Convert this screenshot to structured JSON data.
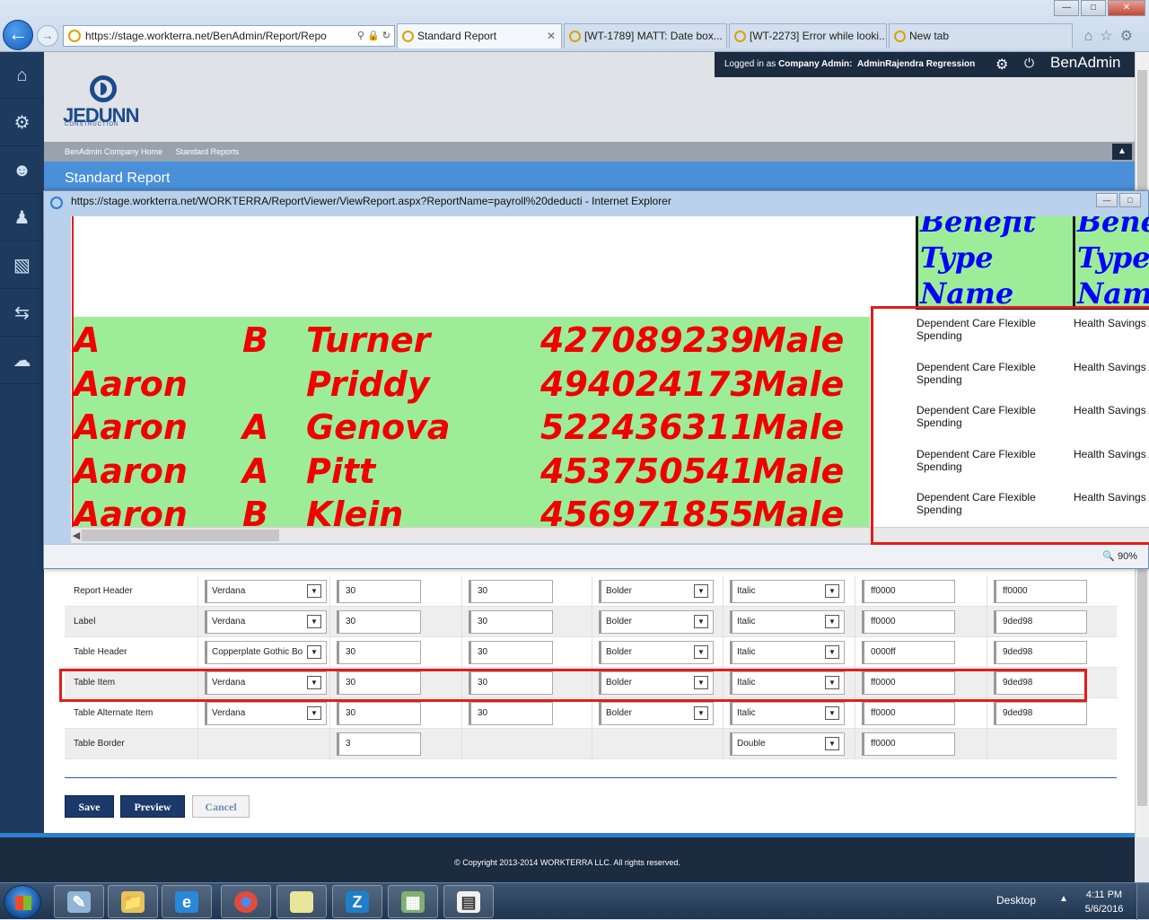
{
  "browser": {
    "address": "https://stage.workterra.net/BenAdmin/Report/Repo",
    "tabs": [
      {
        "label": "Standard Report"
      },
      {
        "label": "[WT-1789] MATT: Date box..."
      },
      {
        "label": "[WT-2273] Error while looki..."
      },
      {
        "label": "New tab"
      }
    ]
  },
  "header": {
    "logo_word": "JEDUNN",
    "logo_sub": "CONSTRUCTION",
    "logged_in_prefix": "Logged in as",
    "user_role": "Company Admin:",
    "user_name": "AdminRajendra Regression",
    "app_name": "BenAdmin"
  },
  "breadcrumb": [
    "BenAdmin Company Home",
    "Standard Reports"
  ],
  "page_title": "Standard Report",
  "popup": {
    "title": "https://stage.workterra.net/WORKTERRA/ReportViewer/ViewReport.aspx?ReportName=payroll%20deducti - Internet Explorer",
    "header_col1": "Benefit Type Name",
    "header_col2": "Benefit Type Name",
    "rows": [
      {
        "first": "A",
        "middle": "B",
        "last": "Turner",
        "ssn": "427089239",
        "gender": "Male",
        "benefit1": "Dependent Care Flexible Spending",
        "benefit2": "Health Savings Accou"
      },
      {
        "first": "Aaron",
        "middle": "",
        "last": "Priddy",
        "ssn": "494024173",
        "gender": "Male",
        "benefit1": "Dependent Care Flexible Spending",
        "benefit2": "Health Savings Accou"
      },
      {
        "first": "Aaron",
        "middle": "A",
        "last": "Genova",
        "ssn": "522436311",
        "gender": "Male",
        "benefit1": "Dependent Care Flexible Spending",
        "benefit2": "Health Savings Accou"
      },
      {
        "first": "Aaron",
        "middle": "A",
        "last": "Pitt",
        "ssn": "453750541",
        "gender": "Male",
        "benefit1": "Dependent Care Flexible Spending",
        "benefit2": "Health Savings Accou"
      },
      {
        "first": "Aaron",
        "middle": "B",
        "last": "Klein",
        "ssn": "456971855",
        "gender": "Male",
        "benefit1": "Dependent Care Flexible Spending",
        "benefit2": "Health Savings Accou"
      }
    ],
    "zoom": "90%"
  },
  "settings": [
    {
      "label": "Report Header",
      "font": "Verdana",
      "size1": "30",
      "size2": "30",
      "weight": "Bolder",
      "style": "Italic",
      "color1": "ff0000",
      "color2": "ff0000"
    },
    {
      "label": "Label",
      "font": "Verdana",
      "size1": "30",
      "size2": "30",
      "weight": "Bolder",
      "style": "Italic",
      "color1": "ff0000",
      "color2": "9ded98"
    },
    {
      "label": "Table Header",
      "font": "Copperplate Gothic Bo",
      "size1": "30",
      "size2": "30",
      "weight": "Bolder",
      "style": "Italic",
      "color1": "0000ff",
      "color2": "9ded98"
    },
    {
      "label": "Table Item",
      "font": "Verdana",
      "size1": "30",
      "size2": "30",
      "weight": "Bolder",
      "style": "Italic",
      "color1": "ff0000",
      "color2": "9ded98"
    },
    {
      "label": "Table Alternate Item",
      "font": "Verdana",
      "size1": "30",
      "size2": "30",
      "weight": "Bolder",
      "style": "Italic",
      "color1": "ff0000",
      "color2": "9ded98"
    },
    {
      "label": "Table Border",
      "size1": "3",
      "border_style": "Double",
      "color1": "ff0000"
    }
  ],
  "buttons": {
    "save": "Save",
    "preview": "Preview",
    "cancel": "Cancel"
  },
  "footer": "© Copyright 2013-2014 WORKTERRA LLC. All rights reserved.",
  "taskbar": {
    "desktop": "Desktop",
    "time": "4:11 PM",
    "date": "5/6/2016"
  },
  "colors": {
    "report_green": "#9ded98",
    "report_red": "#ff0000",
    "header_blue": "#0000ff",
    "nav_dark": "#1b2b40",
    "accent_blue": "#4a90d9"
  }
}
